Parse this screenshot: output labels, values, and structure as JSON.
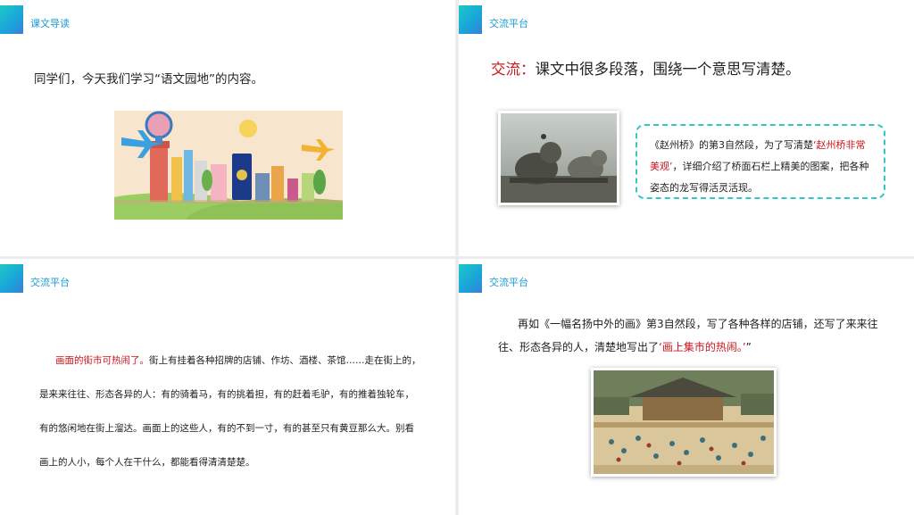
{
  "slides": [
    {
      "title": "课文导读",
      "intro": "同学们，今天我们学习“语文园地”的内容。",
      "illustration": {
        "icon": "travel-landmarks-cartoon",
        "plane_colors": [
          "#3aa0e0",
          "#f2b233"
        ]
      }
    },
    {
      "title": "交流平台",
      "heading_highlight": "交流",
      "heading_colon": "：",
      "heading_rest": "课文中很多段落，围绕一个意思写清楚。",
      "photo_icon": "stone-lion-carving-photo",
      "callout": {
        "part1": "《赵州桥》的第3自然段，为了写清楚",
        "highlight": "‘赵州桥非常美观’",
        "part2": "，详细介绍了桥面石栏上精美的图案，把各种姿态的龙写得活灵活现。"
      }
    },
    {
      "title": "交流平台",
      "highlight": "画面的街市可热闹了。",
      "rest": "街上有挂着各种招牌的店铺、作坊、酒楼、茶馆……走在街上的，是来来往往、形态各异的人：有的骑着马，有的挑着担，有的赶着毛驴，有的推着独轮车，有的悠闲地在街上溜达。画面上的这些人，有的不到一寸，有的甚至只有黄豆那么大。别看画上的人小，每个人在干什么，都能看得清清楚楚。"
    },
    {
      "title": "交流平台",
      "part1": "再如《一幅名扬中外的画》第3自然段，写了各种各样的店铺，还写了来来往往、形态各异的人，清楚地写出了",
      "highlight": "‘画上集市的热闹。’",
      "end_quote": "”",
      "painting_icon": "ancient-street-market-painting"
    }
  ],
  "colors": {
    "accent": "#1a9bd7",
    "highlight_red": "#c8161d",
    "callout_border": "#35c6c8"
  }
}
